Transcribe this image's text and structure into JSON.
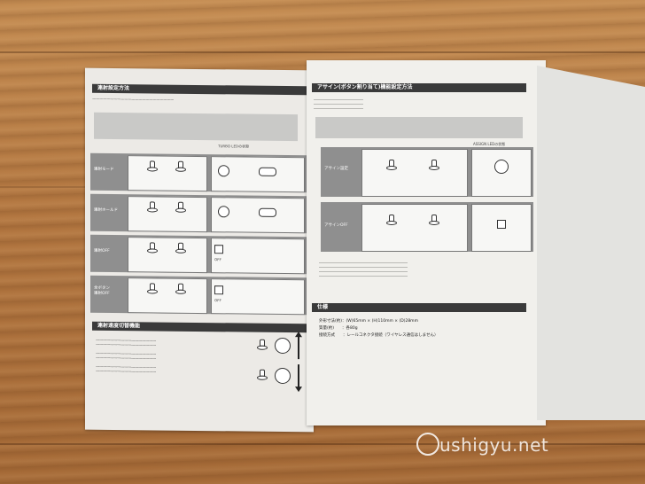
{
  "left_page": {
    "section1_title": "連射設定方法",
    "row_labels": [
      "連射モード",
      "連射ホールド",
      "連射OFF",
      "全ボタン\n連射OFF"
    ],
    "turbo_led_label": "TURBO LEDの状態",
    "off_label": "OFF",
    "section2_title": "連射速度切替機能"
  },
  "right_page": {
    "section1_title": "アサイン(ボタン割り当て)機能設定方法",
    "assign_label": "アサイン設定",
    "assign_off_label": "アサインOFF",
    "assign_col_label": "ASSIGN LEDの状態",
    "spec_title": "仕様",
    "spec_lines": [
      "外形寸法(約)：(W)65mm × (H)110mm × (D)28mm",
      "質量(約)　　：各80g",
      "接続方式　　：レールコネクタ接続（ワイヤレス通信はしません）"
    ]
  },
  "watermark": "ushigyu.net"
}
